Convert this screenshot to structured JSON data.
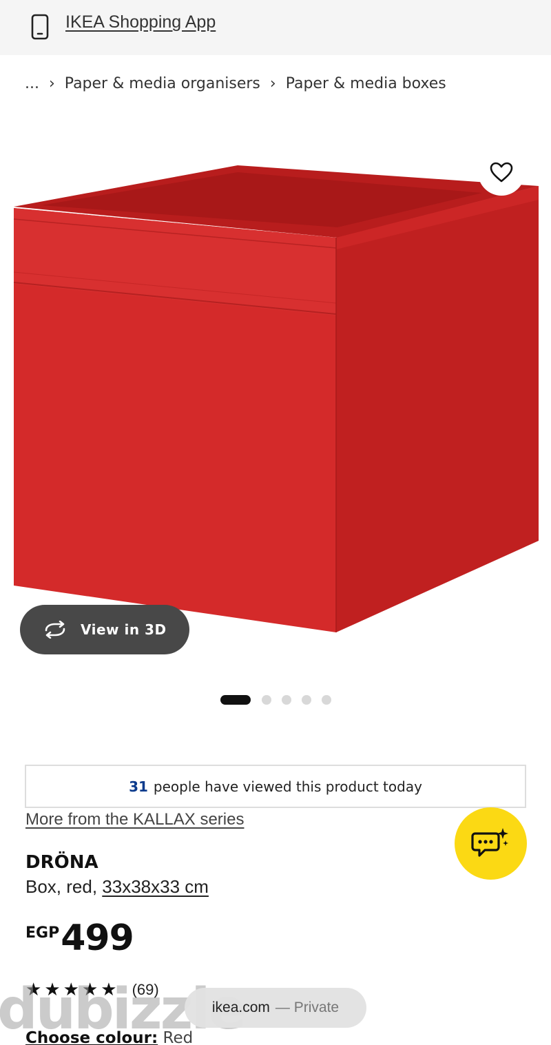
{
  "banner": {
    "app_link": "IKEA Shopping App",
    "icon": "phone-icon"
  },
  "breadcrumb": {
    "items": [
      "...",
      "Paper & media organisers",
      "Paper & media boxes"
    ]
  },
  "gallery": {
    "view_3d_label": "View in 3D",
    "dots_total": 5,
    "active_index": 0
  },
  "social_proof": {
    "count": "31",
    "text": "people have viewed this product today"
  },
  "series_link": "More from the KALLAX series",
  "product": {
    "name": "DRÖNA",
    "description_prefix": "Box, red, ",
    "dimensions": "33x38x33 cm",
    "currency": "EGP",
    "price": "499",
    "rating_value": 4.5,
    "rating_count": "(69)",
    "choose_colour_label": "Choose colour:",
    "colour_value": "Red"
  },
  "browser": {
    "domain": "ikea.com",
    "mode": "— Private"
  },
  "watermark": {
    "text": "dubizzle"
  },
  "colors": {
    "box_red": "#d42a2a",
    "chat_yellow": "#fbd914",
    "link_blue": "#0b3a8c",
    "pill_dark": "#484848"
  }
}
